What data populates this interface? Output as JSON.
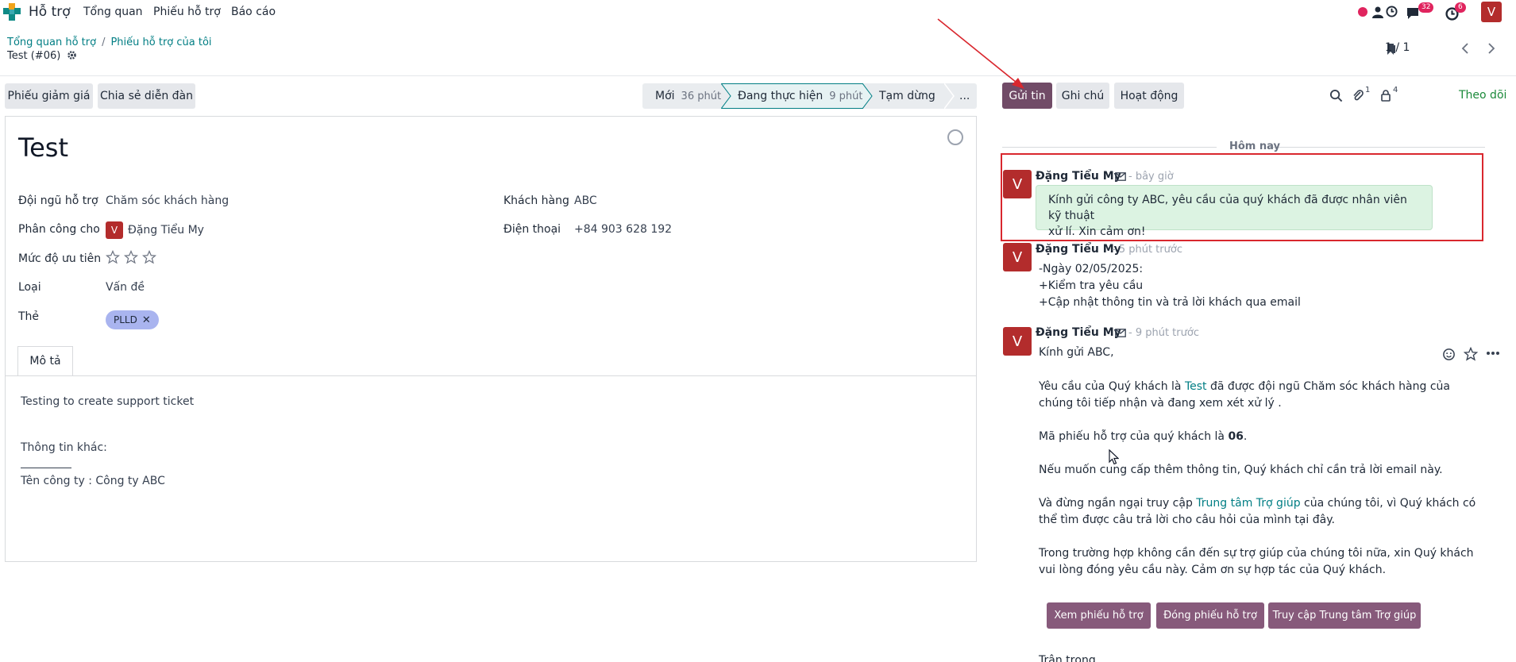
{
  "navbar": {
    "app_name": "Hỗ trợ",
    "menu": [
      "Tổng quan",
      "Phiếu hỗ trợ",
      "Báo cáo"
    ],
    "messages_count": "32",
    "activities_count": "6",
    "user_initial": "V"
  },
  "breadcrumb": {
    "items": [
      "Tổng quan hỗ trợ",
      "Phiếu hỗ trợ của tôi"
    ],
    "current": "Test (#06)"
  },
  "pager": {
    "value": "1 / 1"
  },
  "actions": {
    "coupons": "Phiếu giảm giá",
    "share_forum": "Chia sẻ diễn đàn"
  },
  "stages": [
    {
      "name": "Mới",
      "duration": "36 phút"
    },
    {
      "name": "Đang thực hiện",
      "duration": "9 phút"
    },
    {
      "name": "Tạm dừng",
      "duration": ""
    },
    {
      "name": "...",
      "duration": ""
    }
  ],
  "form": {
    "title": "Test",
    "fields": {
      "team_label": "Đội ngũ hỗ trợ",
      "team_value": "Chăm sóc khách hàng",
      "assigned_label": "Phân công cho",
      "assigned_value": "Đặng Tiểu My",
      "assigned_initial": "V",
      "priority_label": "Mức độ ưu tiên",
      "priority_stars": 0,
      "type_label": "Loại",
      "type_value": "Vấn đề",
      "tags_label": "Thẻ",
      "tag": "PLLD",
      "customer_label": "Khách hàng",
      "customer_value": "ABC",
      "phone_label": "Điện thoại",
      "phone_value": "+84 903 628 192"
    },
    "tab_label": "Mô tả",
    "description": {
      "line1": "Testing to create support ticket",
      "line2": "Thông tin khác:",
      "line3": "Tên công ty : Công ty ABC"
    }
  },
  "chatter": {
    "send_message": "Gửi tin",
    "log_note": "Ghi chú",
    "activities": "Hoạt động",
    "attachments_count": "1",
    "followers_count": "4",
    "follow": "Theo dõi",
    "today": "Hôm nay",
    "messages": [
      {
        "author": "Đặng Tiểu My",
        "initial": "V",
        "time": "- bây giờ",
        "body_line1": "Kính gửi công ty ABC, yêu cầu của quý khách đã được nhân viên kỹ thuật",
        "body_line2": "xử lí. Xin cảm ơn!"
      },
      {
        "author": "Đặng Tiểu My",
        "initial": "V",
        "time": "- 5 phút trước",
        "lines": [
          "-Ngày 02/05/2025:",
          "+Kiểm tra yêu cầu",
          "+Cập nhật thông tin và trả lời khách qua email"
        ]
      },
      {
        "author": "Đặng Tiểu My",
        "initial": "V",
        "time": "- 9 phút trước",
        "greeting": "Kính gửi ABC,",
        "p1_a": "Yêu cầu của Quý khách là ",
        "p1_link": "Test",
        "p1_b": " đã được đội ngũ Chăm sóc khách hàng của",
        "p1_c": "chúng tôi tiếp nhận và đang xem xét xử lý .",
        "p2_a": "Mã phiếu hỗ trợ của quý khách là ",
        "p2_num": "06",
        "p2_b": ".",
        "p3": "Nếu muốn cung cấp thêm thông tin, Quý khách chỉ cần trả lời email này.",
        "p4_a": "Và đừng ngần ngại truy cập ",
        "p4_link": "Trung tâm Trợ giúp",
        "p4_b": " của chúng tôi, vì Quý khách có",
        "p4_c": "thể tìm được câu trả lời cho câu hỏi của mình tại đây.",
        "p5_a": "Trong trường hợp không cần đến sự trợ giúp của chúng tôi nữa, xin Quý khách",
        "p5_b": "vui lòng đóng yêu cầu này. Cảm ơn sự hợp tác của Quý khách.",
        "buttons": [
          "Xem phiếu hỗ trợ",
          "Đóng phiếu hỗ trợ",
          "Truy cập Trung tâm Trợ giúp"
        ],
        "closing": "Trân trọng"
      }
    ]
  },
  "colors": {
    "brand": "#714b67",
    "link": "#017e84",
    "avatar": "#b32c2c",
    "annotation": "#d9272e"
  }
}
